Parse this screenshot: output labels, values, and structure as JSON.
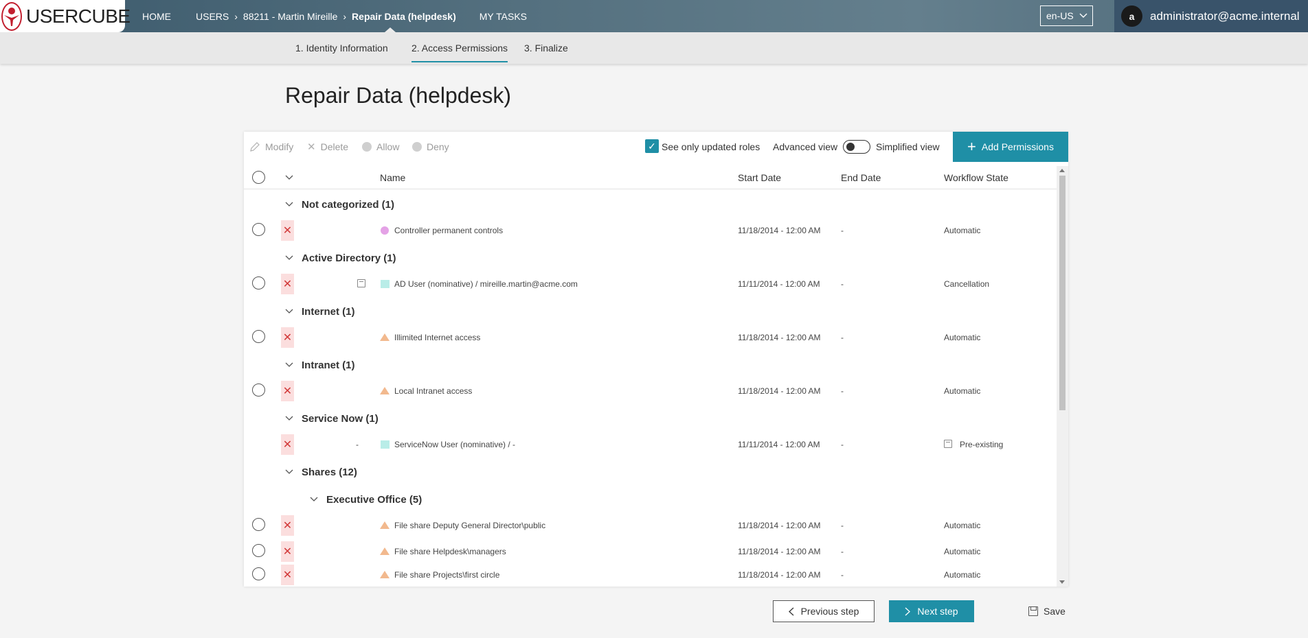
{
  "app": {
    "logo_text": "USERCUBE",
    "nav": {
      "home": "HOME",
      "users": "USERS",
      "user": "88211 - Martin Mireille",
      "current": "Repair Data (helpdesk)",
      "tasks": "MY TASKS"
    },
    "language": "en-US",
    "user_initial": "a",
    "user_email": "administrator@acme.internal"
  },
  "steps": [
    "1. Identity Information",
    "2. Access Permissions",
    "3. Finalize"
  ],
  "page_title": "Repair Data (helpdesk)",
  "toolbar": {
    "modify": "Modify",
    "delete": "Delete",
    "allow": "Allow",
    "deny": "Deny",
    "see_only_updated": "See only updated roles",
    "advanced_view": "Advanced view",
    "simplified_view": "Simplified view",
    "add_permissions": "Add Permissions"
  },
  "columns": {
    "name": "Name",
    "start": "Start Date",
    "end": "End Date",
    "workflow": "Workflow State"
  },
  "groups": [
    {
      "title": "Not categorized (1)"
    },
    {
      "title": "Active Directory (1)"
    },
    {
      "title": "Internet (1)"
    },
    {
      "title": "Intranet (1)"
    },
    {
      "title": "Service Now (1)"
    },
    {
      "title": "Shares (12)"
    },
    {
      "title": "Executive Office (5)"
    }
  ],
  "rows": [
    {
      "name": "Controller permanent controls",
      "start": "11/18/2014  - 12:00 AM",
      "end": "-",
      "workflow": "Automatic",
      "shape": "dot"
    },
    {
      "name": "AD User (nominative) / mireille.martin@acme.com",
      "start": "11/11/2014  - 12:00 AM",
      "end": "-",
      "workflow": "Cancellation",
      "shape": "square"
    },
    {
      "name": "Illimited Internet access",
      "start": "11/18/2014  - 12:00 AM",
      "end": "-",
      "workflow": "Automatic",
      "shape": "triangle"
    },
    {
      "name": "Local Intranet access",
      "start": "11/18/2014  - 12:00 AM",
      "end": "-",
      "workflow": "Automatic",
      "shape": "triangle"
    },
    {
      "name": "ServiceNow User (nominative) / -",
      "start": "11/11/2014  - 12:00 AM",
      "end": "-",
      "workflow": "Pre-existing",
      "shape": "square",
      "prefix": "-"
    },
    {
      "name": "File share Deputy General Director\\public",
      "start": "11/18/2014  - 12:00 AM",
      "end": "-",
      "workflow": "Automatic",
      "shape": "triangle"
    },
    {
      "name": "File share Helpdesk\\managers",
      "start": "11/18/2014  - 12:00 AM",
      "end": "-",
      "workflow": "Automatic",
      "shape": "triangle"
    },
    {
      "name": "File share Projects\\first circle",
      "start": "11/18/2014  - 12:00 AM",
      "end": "-",
      "workflow": "Automatic",
      "shape": "triangle"
    }
  ],
  "footer": {
    "previous": "Previous step",
    "next": "Next step",
    "save": "Save"
  },
  "colors": {
    "accent": "#1f8fa6",
    "deny_bg": "#fbdede",
    "deny_x": "#d23a3a"
  }
}
